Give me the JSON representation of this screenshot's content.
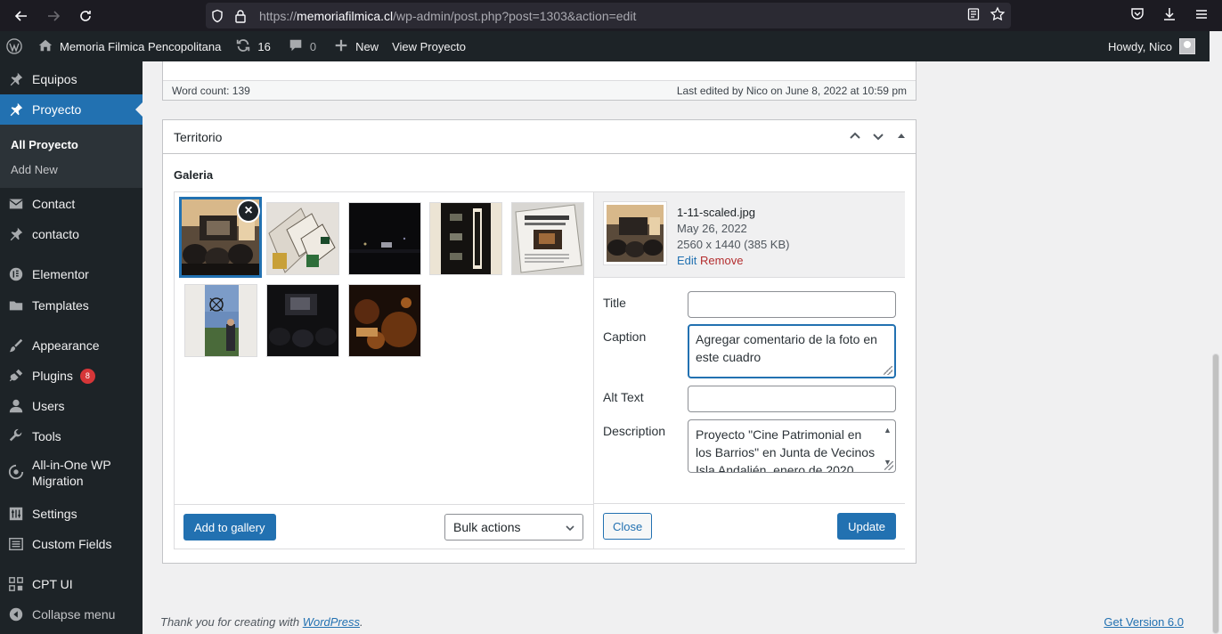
{
  "browser": {
    "url_prefix": "https://",
    "url_domain": "memoriafilmica.cl",
    "url_path": "/wp-admin/post.php?post=1303&action=edit"
  },
  "adminbar": {
    "site_name": "Memoria Filmica Pencopolitana",
    "updates_count": "16",
    "comments_count": "0",
    "new_label": "New",
    "view_label": "View Proyecto",
    "howdy": "Howdy, Nico"
  },
  "sidebar": {
    "items": [
      {
        "label": "Equipos",
        "icon": "pin-icon"
      },
      {
        "label": "Proyecto",
        "icon": "pin-icon"
      },
      {
        "label": "Contact",
        "icon": "mail-icon"
      },
      {
        "label": "contacto",
        "icon": "pin-icon"
      },
      {
        "label": "Elementor",
        "icon": "elementor-icon"
      },
      {
        "label": "Templates",
        "icon": "folder-icon"
      },
      {
        "label": "Appearance",
        "icon": "brush-icon"
      },
      {
        "label": "Plugins",
        "icon": "plug-icon"
      },
      {
        "label": "Users",
        "icon": "user-icon"
      },
      {
        "label": "Tools",
        "icon": "wrench-icon"
      },
      {
        "label": "All-in-One WP",
        "label2": "Migration",
        "icon": "migration-icon"
      },
      {
        "label": "Settings",
        "icon": "settings-icon"
      },
      {
        "label": "Custom Fields",
        "icon": "fields-icon"
      },
      {
        "label": "CPT UI",
        "icon": "cpt-icon"
      },
      {
        "label": "Collapse menu",
        "icon": "collapse-icon"
      }
    ],
    "plugins_badge": "8",
    "submenu": {
      "all": "All Proyecto",
      "add_new": "Add New"
    }
  },
  "editor_status": {
    "word_count": "Word count: 139",
    "last_edited": "Last edited by Nico on June 8, 2022 at 10:59 pm"
  },
  "postbox": {
    "title": "Territorio",
    "field_label": "Galeria"
  },
  "gallery": {
    "add_button": "Add to gallery",
    "bulk_select": "Bulk actions",
    "remove_glyph": "×"
  },
  "attachment": {
    "filename": "1-11-scaled.jpg",
    "date": "May 26, 2022",
    "dimensions": "2560 x 1440 (385 KB)",
    "edit_label": "Edit",
    "remove_label": "Remove",
    "title_label": "Title",
    "title_value": "",
    "caption_label": "Caption",
    "caption_value": "Agregar comentario de la foto en este cuadro",
    "alt_label": "Alt Text",
    "alt_value": "",
    "description_label": "Description",
    "description_value": "Proyecto \"Cine Patrimonial en los Barrios\" en Junta de Vecinos Isla Andalién, enero de 2020",
    "close_button": "Close",
    "update_button": "Update"
  },
  "footer": {
    "thanks_prefix": "Thank you for creating with ",
    "wordpress_link": "WordPress",
    "thanks_suffix": ".",
    "version_link": "Get Version 6.0"
  },
  "colors": {
    "admin_dark": "#1d2327",
    "accent": "#2271b1",
    "danger": "#d63638"
  }
}
